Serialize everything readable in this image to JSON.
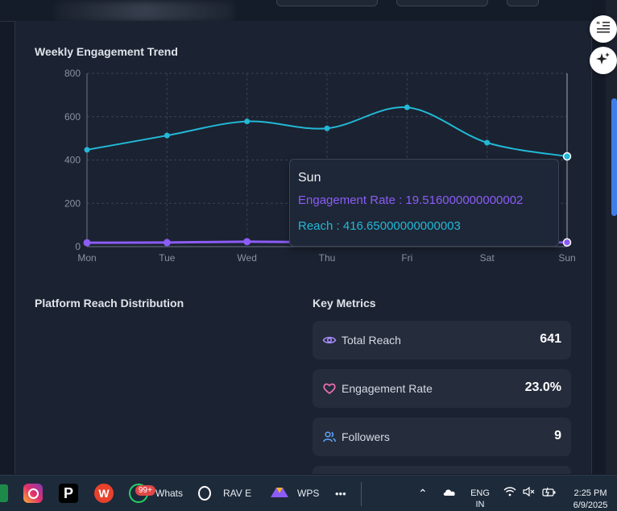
{
  "chart_section": {
    "title": "Weekly Engagement Trend"
  },
  "chart_data": {
    "type": "line",
    "categories": [
      "Mon",
      "Tue",
      "Wed",
      "Thu",
      "Fri",
      "Sat",
      "Sun"
    ],
    "y_ticks": [
      0,
      200,
      400,
      600,
      800
    ],
    "ylim": [
      0,
      800
    ],
    "grid": true,
    "series": [
      {
        "name": "Reach",
        "color": "#22b8d6",
        "values": [
          447,
          513,
          578,
          546,
          643,
          480,
          416.65
        ]
      },
      {
        "name": "Engagement Rate",
        "color": "#8b5cf6",
        "values": [
          18,
          19,
          23,
          20,
          20,
          19,
          19.52
        ]
      }
    ]
  },
  "tooltip": {
    "day": "Sun",
    "engagement_line": "Engagement Rate : 19.516000000000002",
    "reach_line": "Reach : 416.65000000000003"
  },
  "distribution_section": {
    "title": "Platform Reach Distribution"
  },
  "metrics_section": {
    "title": "Key Metrics",
    "items": [
      {
        "label": "Total Reach",
        "value": "641",
        "icon": "eye-icon",
        "icon_color": "#a78bfa"
      },
      {
        "label": "Engagement Rate",
        "value": "23.0%",
        "icon": "heart-icon",
        "icon_color": "#f472b6"
      },
      {
        "label": "Followers",
        "value": "9",
        "icon": "users-icon",
        "icon_color": "#60a5fa"
      }
    ]
  },
  "taskbar": {
    "notification_badge": "99+",
    "whatsapp_label": "Whats",
    "rav_label": "RAV E",
    "wps_label": "WPS",
    "more_label": "•••",
    "lang_top": "ENG",
    "lang_bottom": "IN",
    "time": "2:25 PM",
    "date": "6/9/2025"
  }
}
